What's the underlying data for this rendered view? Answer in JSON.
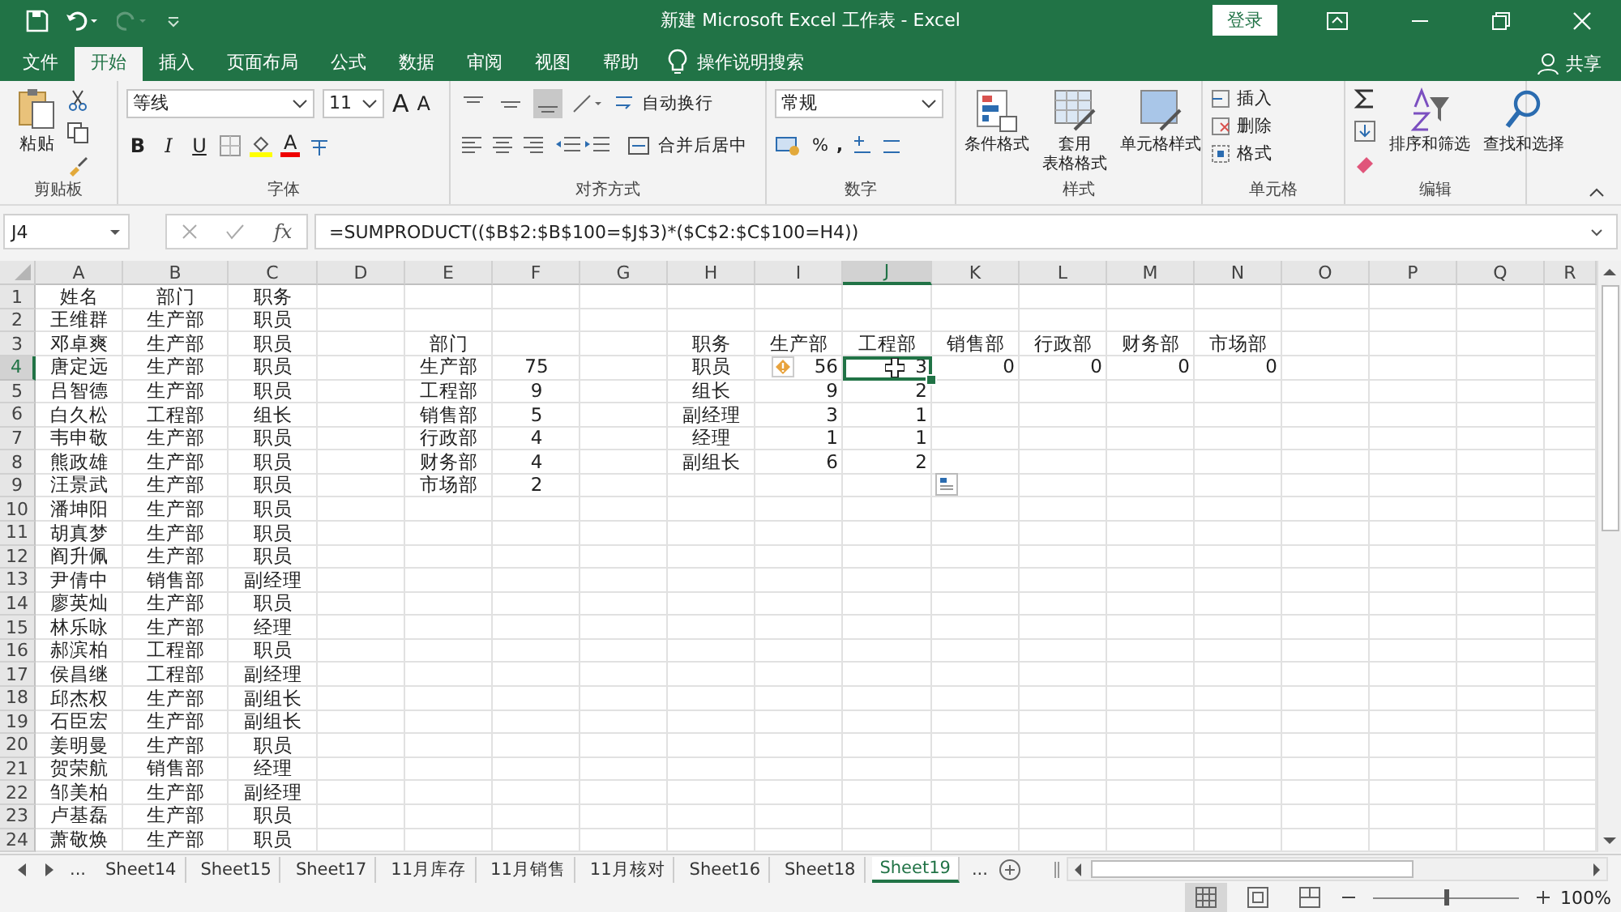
{
  "window": {
    "title": "新建 Microsoft Excel 工作表  -  Excel",
    "sign_in": "登录"
  },
  "ribbon_tabs": [
    {
      "label": "文件",
      "selected": false
    },
    {
      "label": "开始",
      "selected": true
    },
    {
      "label": "插入",
      "selected": false
    },
    {
      "label": "页面布局",
      "selected": false
    },
    {
      "label": "公式",
      "selected": false
    },
    {
      "label": "数据",
      "selected": false
    },
    {
      "label": "审阅",
      "selected": false
    },
    {
      "label": "视图",
      "selected": false
    },
    {
      "label": "帮助",
      "selected": false
    }
  ],
  "tell_me": "操作说明搜索",
  "share": "共享",
  "ribbon": {
    "clipboard": {
      "paste": "粘贴",
      "label": "剪贴板"
    },
    "font": {
      "name": "等线",
      "size": "11",
      "grow": "A",
      "shrink": "A",
      "bold": "B",
      "italic": "I",
      "underline": "U",
      "font_color": "A",
      "label": "字体"
    },
    "alignment": {
      "wrap": "自动换行",
      "merge": "合并后居中",
      "label": "对齐方式"
    },
    "number": {
      "format": "常规",
      "percent": "%",
      "comma": ",",
      "label": "数字"
    },
    "styles": {
      "conditional": "条件格式",
      "table_line1": "套用",
      "table_line2": "表格格式",
      "cell_styles": "单元格样式",
      "label": "样式"
    },
    "cells": {
      "insert": "插入",
      "delete": "删除",
      "format": "格式",
      "label": "单元格"
    },
    "editing": {
      "sort": "排序和筛选",
      "find": "查找和选择",
      "label": "编辑"
    }
  },
  "formula_bar": {
    "name_box": "J4",
    "fx": "fx",
    "formula": "=SUMPRODUCT(($B$2:$B$100=$J$3)*($C$2:$C$100=H4))"
  },
  "columns": [
    {
      "label": "A",
      "selected": false
    },
    {
      "label": "B",
      "selected": false
    },
    {
      "label": "C",
      "selected": false
    },
    {
      "label": "D",
      "selected": false
    },
    {
      "label": "E",
      "selected": false
    },
    {
      "label": "F",
      "selected": false
    },
    {
      "label": "G",
      "selected": false
    },
    {
      "label": "H",
      "selected": false
    },
    {
      "label": "I",
      "selected": false
    },
    {
      "label": "J",
      "selected": true
    },
    {
      "label": "K",
      "selected": false
    },
    {
      "label": "L",
      "selected": false
    },
    {
      "label": "M",
      "selected": false
    },
    {
      "label": "N",
      "selected": false
    },
    {
      "label": "O",
      "selected": false
    },
    {
      "label": "P",
      "selected": false
    },
    {
      "label": "Q",
      "selected": false
    },
    {
      "label": "R",
      "selected": false
    }
  ],
  "row_numbers": [
    {
      "label": "1",
      "selected": false
    },
    {
      "label": "2",
      "selected": false
    },
    {
      "label": "3",
      "selected": false
    },
    {
      "label": "4",
      "selected": true
    },
    {
      "label": "5",
      "selected": false
    },
    {
      "label": "6",
      "selected": false
    },
    {
      "label": "7",
      "selected": false
    },
    {
      "label": "8",
      "selected": false
    },
    {
      "label": "9",
      "selected": false
    },
    {
      "label": "10",
      "selected": false
    },
    {
      "label": "11",
      "selected": false
    },
    {
      "label": "12",
      "selected": false
    },
    {
      "label": "13",
      "selected": false
    },
    {
      "label": "14",
      "selected": false
    },
    {
      "label": "15",
      "selected": false
    },
    {
      "label": "16",
      "selected": false
    },
    {
      "label": "17",
      "selected": false
    },
    {
      "label": "18",
      "selected": false
    },
    {
      "label": "19",
      "selected": false
    },
    {
      "label": "20",
      "selected": false
    },
    {
      "label": "21",
      "selected": false
    },
    {
      "label": "22",
      "selected": false
    },
    {
      "label": "23",
      "selected": false
    },
    {
      "label": "24",
      "selected": false
    }
  ],
  "employees": {
    "header": [
      "姓名",
      "部门",
      "职务"
    ],
    "rows": [
      [
        "王维群",
        "生产部",
        "职员"
      ],
      [
        "邓卓爽",
        "生产部",
        "职员"
      ],
      [
        "唐定远",
        "生产部",
        "职员"
      ],
      [
        "吕智德",
        "生产部",
        "职员"
      ],
      [
        "白久松",
        "工程部",
        "组长"
      ],
      [
        "韦申敬",
        "生产部",
        "职员"
      ],
      [
        "熊政雄",
        "生产部",
        "职员"
      ],
      [
        "汪景武",
        "生产部",
        "职员"
      ],
      [
        "潘坤阳",
        "生产部",
        "职员"
      ],
      [
        "胡真梦",
        "生产部",
        "职员"
      ],
      [
        "阎升佩",
        "生产部",
        "职员"
      ],
      [
        "尹倩中",
        "销售部",
        "副经理"
      ],
      [
        "廖英灿",
        "生产部",
        "职员"
      ],
      [
        "林乐咏",
        "生产部",
        "经理"
      ],
      [
        "郝滨柏",
        "工程部",
        "职员"
      ],
      [
        "侯昌继",
        "工程部",
        "副经理"
      ],
      [
        "邱杰权",
        "生产部",
        "副组长"
      ],
      [
        "石臣宏",
        "生产部",
        "副组长"
      ],
      [
        "姜明曼",
        "生产部",
        "职员"
      ],
      [
        "贺荣航",
        "销售部",
        "经理"
      ],
      [
        "邹美柏",
        "生产部",
        "副经理"
      ],
      [
        "卢基磊",
        "生产部",
        "职员"
      ],
      [
        "萧敬焕",
        "生产部",
        "职员"
      ]
    ]
  },
  "department_summary": {
    "header": "部门",
    "rows": [
      {
        "name": "生产部",
        "count": "75"
      },
      {
        "name": "工程部",
        "count": "9"
      },
      {
        "name": "销售部",
        "count": "5"
      },
      {
        "name": "行政部",
        "count": "4"
      },
      {
        "name": "财务部",
        "count": "4"
      },
      {
        "name": "市场部",
        "count": "2"
      }
    ]
  },
  "position_matrix": {
    "header": [
      "职务",
      "生产部",
      "工程部",
      "销售部",
      "行政部",
      "财务部",
      "市场部"
    ],
    "rows": [
      {
        "label": "职员",
        "values": [
          {
            "text": "56",
            "selected": false
          },
          {
            "text": "3",
            "selected": true
          },
          {
            "text": "0",
            "selected": false
          },
          {
            "text": "0",
            "selected": false
          },
          {
            "text": "0",
            "selected": false
          },
          {
            "text": "0",
            "selected": false
          }
        ]
      },
      {
        "label": "组长",
        "values": [
          {
            "text": "9",
            "selected": false
          },
          {
            "text": "2",
            "selected": false
          }
        ]
      },
      {
        "label": "副经理",
        "values": [
          {
            "text": "3",
            "selected": false
          },
          {
            "text": "1",
            "selected": false
          }
        ]
      },
      {
        "label": "经理",
        "values": [
          {
            "text": "1",
            "selected": false
          },
          {
            "text": "1",
            "selected": false
          }
        ]
      },
      {
        "label": "副组长",
        "values": [
          {
            "text": "6",
            "selected": false
          },
          {
            "text": "2",
            "selected": false
          }
        ]
      }
    ]
  },
  "sheet_tabs": {
    "more_left": "...",
    "tabs": [
      {
        "label": "Sheet14",
        "selected": false
      },
      {
        "label": "Sheet15",
        "selected": false
      },
      {
        "label": "Sheet17",
        "selected": false
      },
      {
        "label": "11月库存",
        "selected": false
      },
      {
        "label": "11月销售",
        "selected": false
      },
      {
        "label": "11月核对",
        "selected": false
      },
      {
        "label": "Sheet16",
        "selected": false
      },
      {
        "label": "Sheet18",
        "selected": false
      },
      {
        "label": "Sheet19",
        "selected": true
      }
    ],
    "more_right": "..."
  },
  "status_bar": {
    "views": [
      {
        "kind": "normal",
        "selected": true
      },
      {
        "kind": "layout",
        "selected": false
      },
      {
        "kind": "pagebreak",
        "selected": false
      }
    ],
    "zoom": {
      "level": 0.5,
      "reading": "100%"
    }
  }
}
